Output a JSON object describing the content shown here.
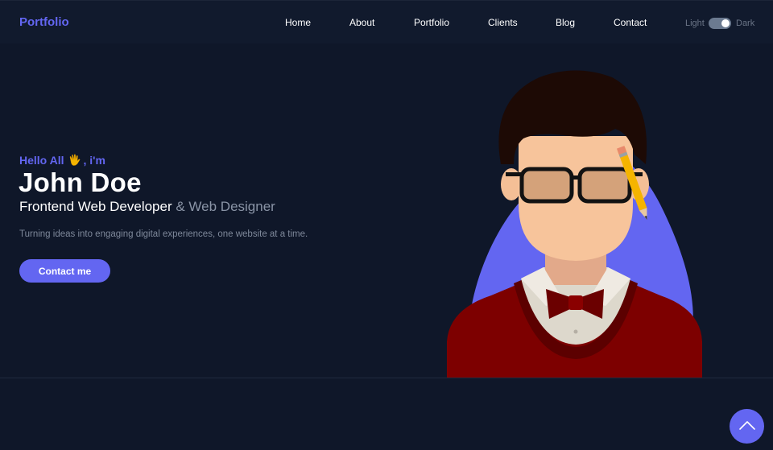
{
  "brand": "Portfolio",
  "nav": {
    "items": [
      "Home",
      "About",
      "Portfolio",
      "Clients",
      "Blog",
      "Contact"
    ]
  },
  "theme": {
    "light_label": "Light",
    "dark_label": "Dark",
    "mode": "dark"
  },
  "hero": {
    "greeting_prefix": "Hello All",
    "greeting_suffix": ", i'm",
    "name": "John Doe",
    "role_primary": "Frontend Web Developer",
    "role_secondary": "& Web Designer",
    "tagline": "Turning ideas into engaging digital experiences, one website at a time.",
    "cta_label": "Contact me"
  },
  "colors": {
    "accent": "#6366f1",
    "background": "#0f1729",
    "navbar": "#111a2d"
  },
  "icons": {
    "greeting": "waving-hand-icon",
    "scroll_top": "chevron-up-icon"
  }
}
